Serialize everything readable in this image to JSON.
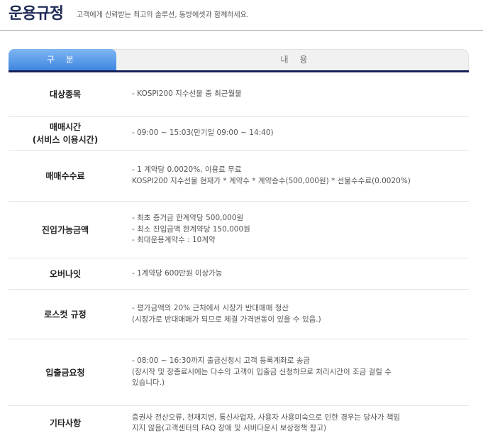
{
  "header": {
    "title": "운용규정",
    "subtitle": "고객에게 신뢰받는 최고의 솔루션, 동방에셋과 함께하세요."
  },
  "tabs": {
    "category": "구 분",
    "content": "내 용"
  },
  "rows": [
    {
      "label": [
        "대상종목"
      ],
      "lines": [
        "- KOSPI200 지수선물 중 최근월물"
      ]
    },
    {
      "label": [
        "매매시간",
        "(서비스 이용시간)"
      ],
      "lines": [
        "- 09:00 ~ 15:03(만기일 09:00 ~ 14:40)"
      ]
    },
    {
      "label": [
        "매매수수료"
      ],
      "lines": [
        "- 1 계약당 0.0020%, 이용료 무료",
        "KOSPI200 지수선물 현재가 * 계약수 * 계약승수(500,000원) * 선물수수료(0.0020%)"
      ]
    },
    {
      "label": [
        "진입가능금액"
      ],
      "lines": [
        "- 최초 증거금 한계약당 500,000원",
        "- 최소 진입금액 한계약당 150,000원",
        "- 최대운용계약수 : 10계약"
      ]
    },
    {
      "label": [
        "오버나잇"
      ],
      "lines": [
        "- 1계약당 600만원 이상가능"
      ]
    },
    {
      "label": [
        "로스컷 규정"
      ],
      "lines": [
        "- 평가금액의 20% 근처에서 시장가 반대매매 청산",
        "(시장가로 반대매매가 되므로 체결 가격변동이 있을 수 있음.)"
      ]
    },
    {
      "label": [
        "입출금요청"
      ],
      "lines": [
        "- 08:00 ~ 16:30까지 출금신청시 고객 등록계좌로 송금",
        "(장시작 및 장종료시에는 다수의 고객이 입출금 신청하므로 처리시간이 조금 걸릴 수",
        "있습니다.)"
      ]
    },
    {
      "label": [
        "기타사항"
      ],
      "lines": [
        "증권사 전산오류, 천재지변, 통신사업자, 사용자 사용미숙으로 인한 경우는 당사가 책임",
        "지지 않음(고객센터의 FAQ 장애 및 서버다운시 보상정책 참고)"
      ]
    }
  ]
}
